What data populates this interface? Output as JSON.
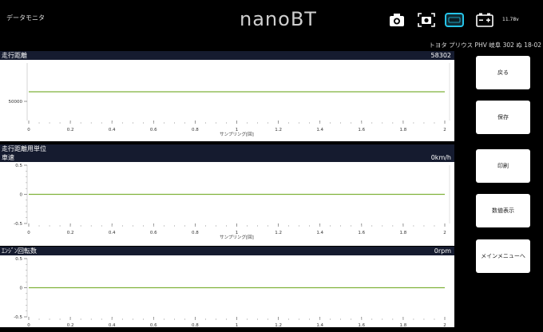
{
  "app": {
    "title": "データモニタ",
    "logo": "nanoBT",
    "voltage": "11.78v",
    "vehicle_info": "トヨタ プリウス PHV 岐阜 302 ぬ 18-02",
    "icons": [
      "camera-icon",
      "screenshot-icon",
      "connect-icon",
      "battery-icon"
    ]
  },
  "panels": {
    "distance": {
      "label": "走行距離",
      "value": "58302"
    },
    "distance_unit": {
      "label": "走行距離用単位"
    },
    "speed": {
      "label": "車速",
      "value": "0km/h"
    },
    "rpm": {
      "label": "ｴﾝｼﾞﾝ回転数",
      "value": "0rpm"
    }
  },
  "sidebar": {
    "back": "戻る",
    "save": "保存",
    "print": "印刷",
    "numeric": "数値表示",
    "main_menu": "メインメニューへ"
  },
  "chart_data": [
    {
      "type": "line",
      "title": "走行距離",
      "xlabel": "サンプリング[回]",
      "x_ticks": [
        "0",
        "0.2",
        "0.4",
        "0.6",
        "0.8",
        "1",
        "1.2",
        "1.4",
        "1.6",
        "1.8",
        "2"
      ],
      "y_ticks": [
        "50000"
      ],
      "xlim": [
        0,
        2
      ],
      "series": [
        {
          "x": [
            0,
            2
          ],
          "y": [
            58302,
            58302
          ],
          "color": "#7fb23a"
        }
      ]
    },
    {
      "type": "line",
      "title": "車速",
      "xlabel": "サンプリング[回]",
      "x_ticks": [
        "0",
        "0.2",
        "0.4",
        "0.6",
        "0.8",
        "1",
        "1.2",
        "1.4",
        "1.6",
        "1.8",
        "2"
      ],
      "y_ticks": [
        "0.5",
        "0",
        "-0.5"
      ],
      "xlim": [
        0,
        2
      ],
      "ylim": [
        -0.5,
        0.5
      ],
      "series": [
        {
          "x": [
            0,
            2
          ],
          "y": [
            0,
            0
          ],
          "color": "#7fb23a"
        }
      ]
    },
    {
      "type": "line",
      "title": "ｴﾝｼﾞﾝ回転数",
      "xlabel": "",
      "x_ticks": [
        "0",
        "0.2",
        "0.4",
        "0.6",
        "0.8",
        "1",
        "1.2",
        "1.4",
        "1.6",
        "1.8",
        "2"
      ],
      "y_ticks": [
        "0.5",
        "0",
        "-0.5"
      ],
      "xlim": [
        0,
        2
      ],
      "ylim": [
        -0.5,
        0.5
      ],
      "series": [
        {
          "x": [
            0,
            2
          ],
          "y": [
            0,
            0
          ],
          "color": "#7fb23a"
        }
      ]
    }
  ]
}
